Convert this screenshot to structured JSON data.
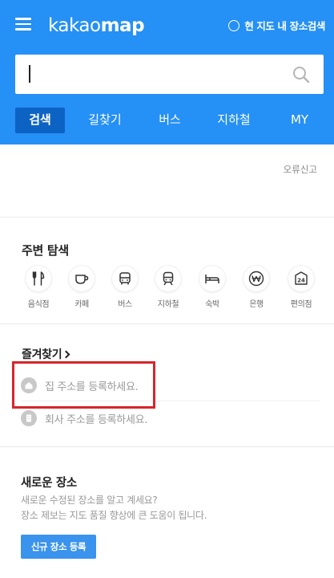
{
  "header": {
    "logo_light": "kakao",
    "logo_bold": "map",
    "map_search_label": "현 지도 내 장소검색",
    "search_value": "",
    "tabs": [
      {
        "label": "검색",
        "active": true
      },
      {
        "label": "길찾기",
        "active": false
      },
      {
        "label": "버스",
        "active": false
      },
      {
        "label": "지하철",
        "active": false
      },
      {
        "label": "MY",
        "active": false
      }
    ]
  },
  "report": {
    "label": "오류신고"
  },
  "nearby": {
    "title": "주변 탐색",
    "categories": [
      {
        "label": "음식점",
        "icon": "fork-knife-icon"
      },
      {
        "label": "카페",
        "icon": "coffee-cup-icon"
      },
      {
        "label": "버스",
        "icon": "bus-icon"
      },
      {
        "label": "지하철",
        "icon": "subway-icon"
      },
      {
        "label": "숙박",
        "icon": "bed-icon"
      },
      {
        "label": "은행",
        "icon": "won-icon"
      },
      {
        "label": "편의점",
        "icon": "store-24-icon"
      }
    ]
  },
  "favorites": {
    "title": "즐겨찾기",
    "home": "집 주소를 등록하세요.",
    "office": "회사 주소를 등록하세요."
  },
  "new_place": {
    "title": "새로운 장소",
    "desc_line1": "새로운 수정된 장소를 알고 계세요?",
    "desc_line2": "장소 제보는 지도 품질 향상에 큰 도움이 됩니다.",
    "button_label": "신규 장소 등록"
  },
  "colors": {
    "brand": "#2590f5",
    "active_tab": "#0c63c4",
    "highlight": "#d6262c",
    "button": "#3a93ec"
  }
}
